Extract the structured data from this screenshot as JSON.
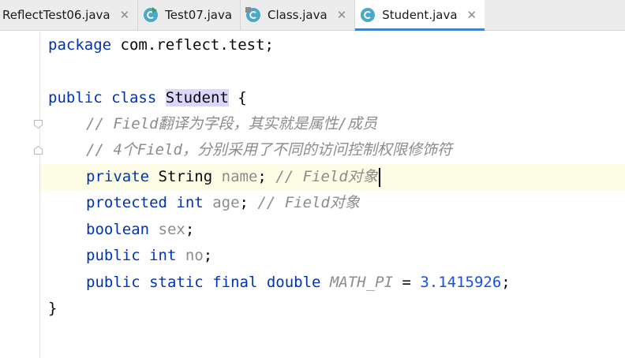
{
  "tabs": [
    {
      "label": "ReflectTest06.java",
      "icon": "none",
      "active": false,
      "closable": true
    },
    {
      "label": "Test07.java",
      "icon": "run-class-icon",
      "active": false,
      "closable": false
    },
    {
      "label": "Class.java",
      "icon": "library-class-icon",
      "active": false,
      "closable": true
    },
    {
      "label": "Student.java",
      "icon": "class-icon",
      "active": true,
      "closable": true
    }
  ],
  "close_glyph": "✕",
  "colors": {
    "keyword": "#0033b3",
    "comment": "#8c8c8c",
    "number": "#1750eb",
    "constant": "#871094",
    "highlight": "#dad7fb",
    "caret_line": "#fdfce5",
    "tab_accent": "#4083c9",
    "class_icon": "#4aa8c8"
  },
  "code": {
    "l1": {
      "kw": "package",
      "rest": " com.reflect.test;"
    },
    "l3": {
      "kw1": "public",
      "kw2": "class",
      "name": "Student",
      "brace": " {"
    },
    "l4": {
      "comment": "// Field翻译为字段，其实就是属性/成员"
    },
    "l5": {
      "comment": "// 4个Field，分别采用了不同的访问控制权限修饰符"
    },
    "l6": {
      "kw": "private",
      "type": "String",
      "field": "name",
      "semi": ";",
      "comment": "// Field对象"
    },
    "l7": {
      "kw": "protected",
      "type": "int",
      "field": "age",
      "semi": ";",
      "comment": "// Field对象"
    },
    "l8": {
      "type": "boolean",
      "field": "sex",
      "semi": ";"
    },
    "l9": {
      "kw": "public",
      "type": "int",
      "field": "no",
      "semi": ";"
    },
    "l10": {
      "kw1": "public",
      "kw2": "static",
      "kw3": "final",
      "type": "double",
      "const": "MATH_PI",
      "eq": " = ",
      "num": "3.1415926",
      "semi": ";"
    },
    "l11": {
      "brace": "}"
    }
  }
}
